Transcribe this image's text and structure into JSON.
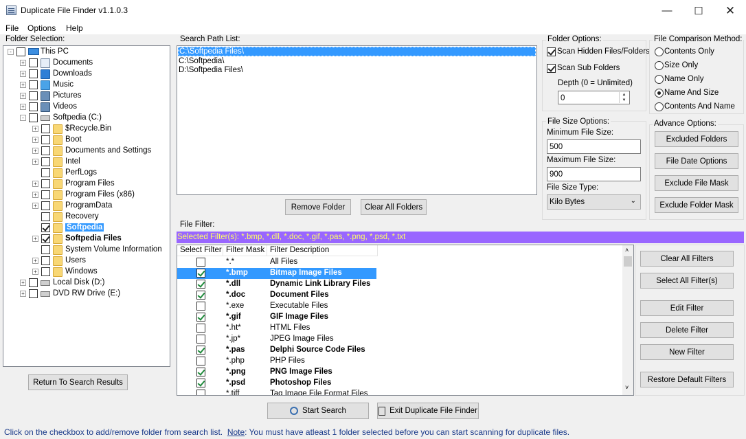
{
  "window": {
    "title": "Duplicate File Finder v1.1.0.3"
  },
  "menu": {
    "items": [
      {
        "label": "File"
      },
      {
        "label": "Options"
      },
      {
        "label": "Help"
      }
    ]
  },
  "folder_selection": {
    "label": "Folder Selection:",
    "tree": [
      {
        "label": "This PC",
        "indent": 0,
        "icon": "computer-icon",
        "checked": false,
        "expand": "-"
      },
      {
        "label": "Documents",
        "indent": 1,
        "icon": "documents-icon",
        "checked": false,
        "expand": "+"
      },
      {
        "label": "Downloads",
        "indent": 1,
        "icon": "download-arrow-icon",
        "checked": false,
        "expand": "+"
      },
      {
        "label": "Music",
        "indent": 1,
        "icon": "music-note-icon",
        "checked": false,
        "expand": "+"
      },
      {
        "label": "Pictures",
        "indent": 1,
        "icon": "pictures-icon",
        "checked": false,
        "expand": "+"
      },
      {
        "label": "Videos",
        "indent": 1,
        "icon": "videos-icon",
        "checked": false,
        "expand": "+"
      },
      {
        "label": "Softpedia (C:)",
        "indent": 1,
        "icon": "drive-icon",
        "checked": false,
        "expand": "-"
      },
      {
        "label": "$Recycle.Bin",
        "indent": 2,
        "icon": "folder-icon",
        "checked": false,
        "expand": "+"
      },
      {
        "label": "Boot",
        "indent": 2,
        "icon": "folder-icon",
        "checked": false,
        "expand": "+"
      },
      {
        "label": "Documents and Settings",
        "indent": 2,
        "icon": "folder-icon",
        "checked": false,
        "expand": "+"
      },
      {
        "label": "Intel",
        "indent": 2,
        "icon": "folder-icon",
        "checked": false,
        "expand": "+"
      },
      {
        "label": "PerfLogs",
        "indent": 2,
        "icon": "folder-icon",
        "checked": false,
        "expand": ""
      },
      {
        "label": "Program Files",
        "indent": 2,
        "icon": "folder-icon",
        "checked": false,
        "expand": "+"
      },
      {
        "label": "Program Files (x86)",
        "indent": 2,
        "icon": "folder-icon",
        "checked": false,
        "expand": "+"
      },
      {
        "label": "ProgramData",
        "indent": 2,
        "icon": "folder-icon",
        "checked": false,
        "expand": "+"
      },
      {
        "label": "Recovery",
        "indent": 2,
        "icon": "folder-icon",
        "checked": false,
        "expand": ""
      },
      {
        "label": "Softpedia",
        "indent": 2,
        "icon": "folder-icon",
        "checked": true,
        "expand": "",
        "selected": true
      },
      {
        "label": "Softpedia Files",
        "indent": 2,
        "icon": "folder-icon",
        "checked": true,
        "expand": "+",
        "bold": true
      },
      {
        "label": "System Volume Information",
        "indent": 2,
        "icon": "folder-icon",
        "checked": false,
        "expand": ""
      },
      {
        "label": "Users",
        "indent": 2,
        "icon": "folder-icon",
        "checked": false,
        "expand": "+"
      },
      {
        "label": "Windows",
        "indent": 2,
        "icon": "folder-icon",
        "checked": false,
        "expand": "+"
      },
      {
        "label": "Local Disk (D:)",
        "indent": 1,
        "icon": "drive-icon",
        "checked": false,
        "expand": "+"
      },
      {
        "label": "DVD RW Drive (E:)",
        "indent": 1,
        "icon": "dvd-drive-icon",
        "checked": false,
        "expand": "+"
      }
    ],
    "return_button": "Return To Search Results"
  },
  "search_path": {
    "label": "Search Path List:",
    "paths": [
      "C:\\Softpedia Files\\",
      "C:\\Softpedia\\",
      "D:\\Softpedia Files\\"
    ],
    "remove_button": "Remove Folder",
    "clear_button": "Clear All Folders"
  },
  "folder_options": {
    "label": "Folder Options:",
    "scan_hidden": "Scan Hidden Files/Folders",
    "scan_sub": "Scan Sub Folders",
    "depth_label": "Depth (0 = Unlimited)",
    "depth_value": "0"
  },
  "comparison": {
    "label": "File Comparison Method:",
    "options": [
      "Contents Only",
      "Size Only",
      "Name Only",
      "Name And Size",
      "Contents And Name"
    ],
    "selected": "Name And Size"
  },
  "size_options": {
    "label": "File Size Options:",
    "min_label": "Minimum File Size:",
    "min_value": "500",
    "max_label": "Maximum File Size:",
    "max_value": "900",
    "type_label": "File Size Type:",
    "type_value": "Kilo Bytes"
  },
  "advance": {
    "label": "Advance Options:",
    "buttons": [
      "Excluded Folders",
      "File Date Options",
      "Exclude File Mask",
      "Exclude Folder Mask"
    ]
  },
  "file_filter": {
    "label": "File Filter:",
    "selected_text": "Selected Filter(s): *.bmp, *.dll, *.doc, *.gif, *.pas, *.png, *.psd, *.txt",
    "columns": [
      "Select Filter",
      "Filter Mask",
      "Filter Description"
    ],
    "rows": [
      {
        "mask": "*.*",
        "desc": "All Files",
        "checked": false
      },
      {
        "mask": "*.bmp",
        "desc": "Bitmap Image Files",
        "checked": true,
        "selected": true
      },
      {
        "mask": "*.dll",
        "desc": "Dynamic Link Library Files",
        "checked": true
      },
      {
        "mask": "*.doc",
        "desc": "Document Files",
        "checked": true
      },
      {
        "mask": "*.exe",
        "desc": "Executable Files",
        "checked": false
      },
      {
        "mask": "*.gif",
        "desc": "GIF Image Files",
        "checked": true
      },
      {
        "mask": "*.ht*",
        "desc": "HTML Files",
        "checked": false
      },
      {
        "mask": "*.jp*",
        "desc": "JPEG Image Files",
        "checked": false
      },
      {
        "mask": "*.pas",
        "desc": "Delphi Source Code Files",
        "checked": true
      },
      {
        "mask": "*.php",
        "desc": "PHP Files",
        "checked": false
      },
      {
        "mask": "*.png",
        "desc": "PNG Image Files",
        "checked": true
      },
      {
        "mask": "*.psd",
        "desc": "Photoshop Files",
        "checked": true
      },
      {
        "mask": "*.tiff",
        "desc": "Tag Image File Format Files",
        "checked": false
      }
    ],
    "buttons": [
      "Clear All Filters",
      "Select All Filter(s)",
      "Edit Filter",
      "Delete Filter",
      "New Filter",
      "Restore Default Filters"
    ]
  },
  "actions": {
    "start": "Start Search",
    "exit": "Exit Duplicate File Finder"
  },
  "status": {
    "prefix": "Click on the checkbox to add/remove folder from search list.",
    "note_label": "Note",
    "note_text": ": You must have atleast 1 folder selected before you can start scanning for duplicate files."
  },
  "colors": {
    "accent": "#3399ff",
    "filter_bar": "#9966ff",
    "filter_text": "#ffff66",
    "status_text": "#1a3a8a"
  }
}
